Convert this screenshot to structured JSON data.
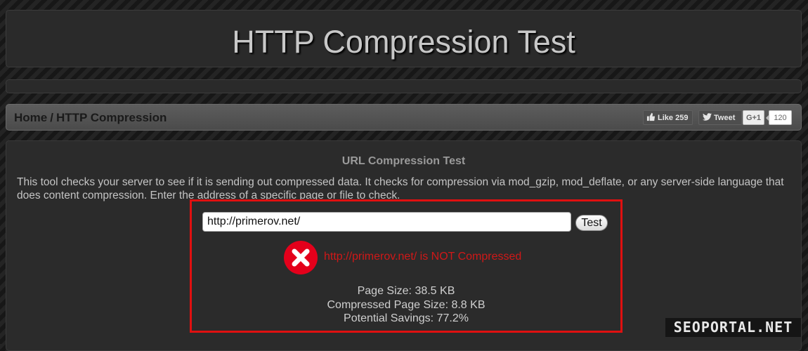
{
  "header": {
    "title": "HTTP Compression Test"
  },
  "breadcrumb": {
    "home": "Home",
    "separator": "/",
    "current": "HTTP Compression"
  },
  "social": {
    "like_label": "Like",
    "like_count": "259",
    "tweet_label": "Tweet",
    "gplus_label": "G+1",
    "gplus_count": "120",
    "icons": [
      "thumbs-up-icon",
      "twitter-bird-icon"
    ]
  },
  "section": {
    "title": "URL Compression Test",
    "intro": "This tool checks your server to see if it is sending out compressed data. It checks for compression via mod_gzip, mod_deflate, or any server-side language that does content compression. Enter the address of a specific page or file to check."
  },
  "form": {
    "url_value": "http://primerov.net/",
    "test_button_label": "Test"
  },
  "result": {
    "status_icon": "error-x-icon",
    "status_message": "http://primerov.net/ is NOT Compressed",
    "page_size": "Page Size: 38.5 KB",
    "compressed_page_size": "Compressed Page Size: 8.8 KB",
    "potential_savings": "Potential Savings: 77.2%"
  },
  "watermark": "SEOPORTAL.NET",
  "colors": {
    "highlight_border": "#e01010",
    "error_red": "#d01818",
    "panel_bg": "#2b2b2b"
  }
}
